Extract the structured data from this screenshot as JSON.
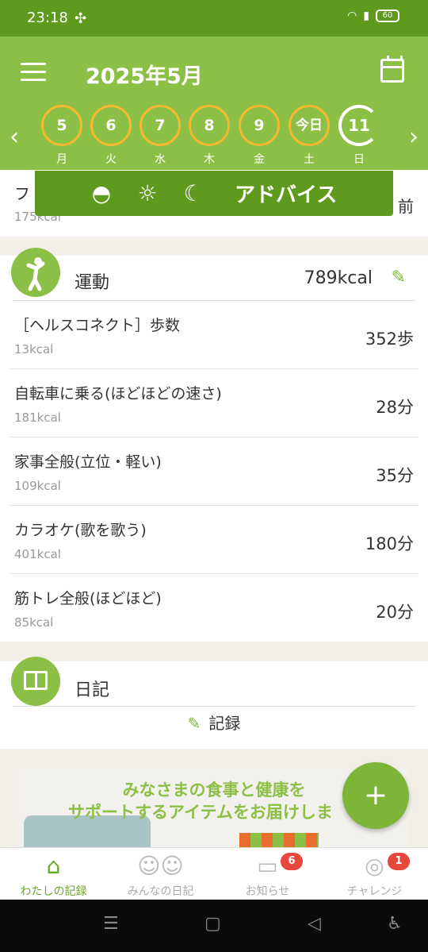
{
  "status_bar": {
    "time": "23:18",
    "battery": "60"
  },
  "header": {
    "title": "2025年5月",
    "days": [
      {
        "num": "5",
        "wk": "月"
      },
      {
        "num": "6",
        "wk": "火"
      },
      {
        "num": "7",
        "wk": "水"
      },
      {
        "num": "8",
        "wk": "木"
      },
      {
        "num": "9",
        "wk": "金"
      },
      {
        "num": "今日",
        "wk": "土"
      },
      {
        "num": "11",
        "wk": "日"
      }
    ]
  },
  "advice": {
    "label": "アドバイス"
  },
  "prev_row": {
    "name": "フ",
    "kcal": "175kcal",
    "value": "前"
  },
  "exercise": {
    "title": "運動",
    "total": "789kcal",
    "items": [
      {
        "name": "［ヘルスコネクト］歩数",
        "kcal": "13kcal",
        "value": "352歩"
      },
      {
        "name": "自転車に乗る(ほどほどの速さ)",
        "kcal": "181kcal",
        "value": "28分"
      },
      {
        "name": "家事全般(立位・軽い)",
        "kcal": "109kcal",
        "value": "35分"
      },
      {
        "name": "カラオケ(歌を歌う)",
        "kcal": "401kcal",
        "value": "180分"
      },
      {
        "name": "筋トレ全般(ほどほど)",
        "kcal": "85kcal",
        "value": "20分"
      }
    ]
  },
  "diary": {
    "title": "日記",
    "record_label": "記録"
  },
  "banner": {
    "line1": "みなさまの食事と健康を",
    "line2": "サポートするアイテムをお届けしま"
  },
  "bottom_nav": {
    "tabs": [
      {
        "label": "わたしの記録"
      },
      {
        "label": "みんなの日記"
      },
      {
        "label": "お知らせ",
        "badge": "6"
      },
      {
        "label": "チャレンジ",
        "badge": "1"
      }
    ]
  }
}
